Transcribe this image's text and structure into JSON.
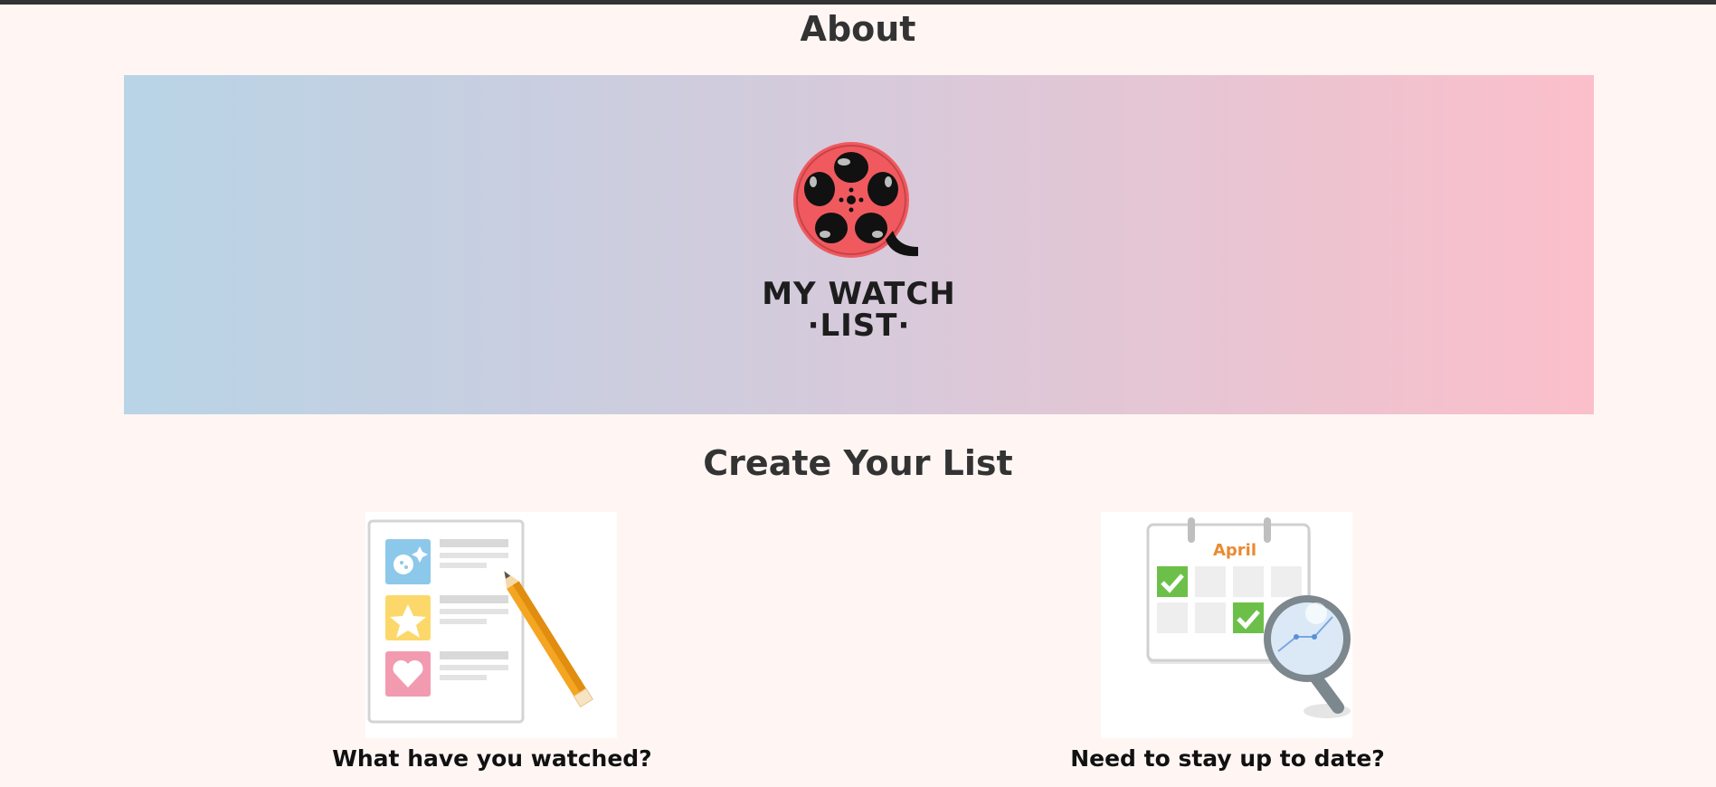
{
  "page": {
    "about_title": "About",
    "create_title": "Create Your List"
  },
  "logo": {
    "line1": "MY WATCH",
    "line2": "·LIST·",
    "reel_color": "#f05a5f",
    "dark_color": "#111111"
  },
  "cards": [
    {
      "caption": "What have you watched?",
      "icon": "checklist-pencil-icon"
    },
    {
      "caption": "Need to stay up to date?",
      "icon": "calendar-magnifier-icon",
      "calendar_month": "April"
    }
  ],
  "colors": {
    "background": "#fff6f3",
    "banner_left": "#b8d4e6",
    "banner_right": "#fbbfca",
    "text": "#333333"
  }
}
